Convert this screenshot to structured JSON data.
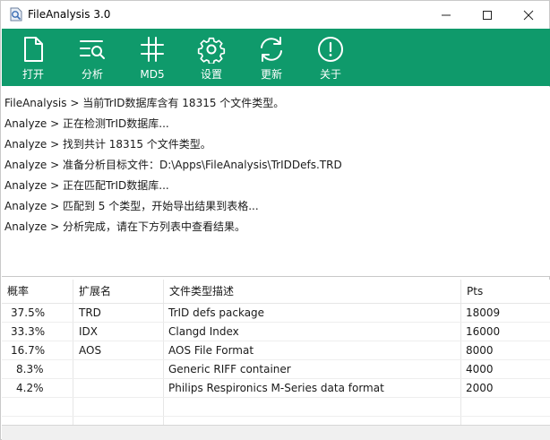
{
  "window": {
    "title": "FileAnalysis 3.0"
  },
  "toolbar": {
    "items": [
      {
        "label": "打开",
        "icon": "file-icon"
      },
      {
        "label": "分析",
        "icon": "list-search-icon"
      },
      {
        "label": "MD5",
        "icon": "hash-icon"
      },
      {
        "label": "设置",
        "icon": "gear-icon"
      },
      {
        "label": "更新",
        "icon": "refresh-icon"
      },
      {
        "label": "关于",
        "icon": "info-icon"
      }
    ],
    "color": "#0f9a6b"
  },
  "log": {
    "lines": [
      "FileAnalysis > 当前TrID数据库含有 18315 个文件类型。",
      "Analyze > 正在检测TrID数据库...",
      "Analyze > 找到共计 18315 个文件类型。",
      "Analyze > 准备分析目标文件：D:\\Apps\\FileAnalysis\\TrIDDefs.TRD",
      "Analyze > 正在匹配TrID数据库...",
      "Analyze > 匹配到 5 个类型，开始导出结果到表格...",
      "Analyze > 分析完成，请在下方列表中查看结果。"
    ]
  },
  "table": {
    "headers": [
      "概率",
      "扩展名",
      "文件类型描述",
      "Pts"
    ],
    "rows": [
      {
        "prob": "37.5%",
        "ext": "TRD",
        "desc": "TrID defs package",
        "pts": "18009"
      },
      {
        "prob": "33.3%",
        "ext": "IDX",
        "desc": "Clangd Index",
        "pts": "16000"
      },
      {
        "prob": "16.7%",
        "ext": "AOS",
        "desc": "AOS File Format",
        "pts": "8000"
      },
      {
        "prob": "8.3%",
        "ext": "",
        "desc": "Generic RIFF container",
        "pts": "4000"
      },
      {
        "prob": "4.2%",
        "ext": "",
        "desc": "Philips Respironics M-Series data format",
        "pts": "2000"
      }
    ]
  }
}
